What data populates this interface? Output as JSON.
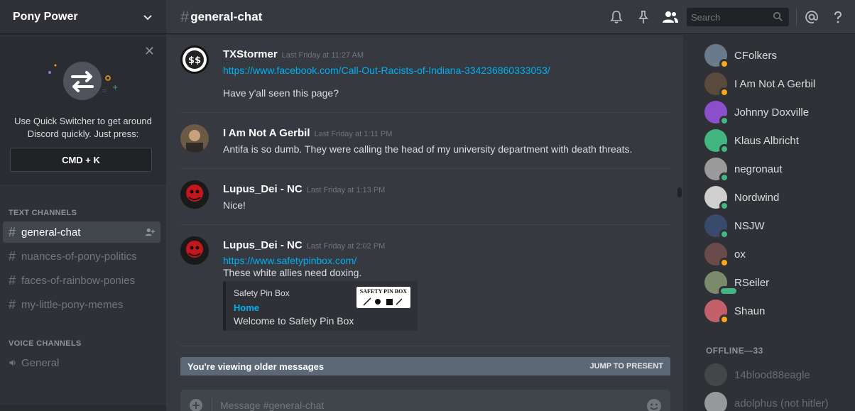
{
  "server": {
    "name": "Pony Power"
  },
  "quick_switcher": {
    "text": "Use Quick Switcher to get around Discord quickly. Just press:",
    "shortcut": "CMD + K"
  },
  "channels": {
    "text_category": "TEXT CHANNELS",
    "text": [
      {
        "name": "general-chat",
        "active": true
      },
      {
        "name": "nuances-of-pony-politics",
        "active": false
      },
      {
        "name": "faces-of-rainbow-ponies",
        "active": false
      },
      {
        "name": "my-little-pony-memes",
        "active": false
      }
    ],
    "voice_category": "VOICE CHANNELS",
    "voice": [
      {
        "name": "General"
      }
    ]
  },
  "header": {
    "channel_name": "general-chat",
    "search_placeholder": "Search"
  },
  "messages": [
    {
      "author": "TXStormer",
      "time": "Last Friday at 11:27 AM",
      "link": "https://www.facebook.com/Call-Out-Racists-of-Indiana-334236860333053/",
      "text": "Have y'all seen this page?"
    },
    {
      "author": "I Am Not A Gerbil",
      "time": "Last Friday at 1:11 PM",
      "text": "Antifa is so dumb. They were calling the head of my university department with death threats."
    },
    {
      "author": "Lupus_Dei - NC",
      "time": "Last Friday at 1:13 PM",
      "text": "Nice!"
    },
    {
      "author": "Lupus_Dei - NC",
      "time": "Last Friday at 2:02 PM",
      "link": "https://www.safetypinbox.com/",
      "text": "These white allies need doxing.",
      "embed": {
        "provider": "Safety Pin Box",
        "title": "Home",
        "description": "Welcome to Safety Pin Box",
        "thumb_text": "SAFETY PIN BOX"
      }
    }
  ],
  "older_bar": {
    "text": "You're viewing older messages",
    "jump": "JUMP TO PRESENT"
  },
  "composer": {
    "placeholder": "Message #general-chat"
  },
  "members": {
    "online": [
      {
        "name": "CFolkers",
        "status": "idle",
        "color": "#dcddde",
        "avatar": "#6b7a8a"
      },
      {
        "name": "I Am Not A Gerbil",
        "status": "idle",
        "color": "#dcddde",
        "avatar": "#5a4a3c"
      },
      {
        "name": "Johnny Doxville",
        "status": "online",
        "color": "#dcddde",
        "avatar": "#8a4fc9"
      },
      {
        "name": "Klaus Albricht",
        "status": "online",
        "color": "#dcddde",
        "avatar": "#43b581"
      },
      {
        "name": "negronaut",
        "status": "online",
        "color": "#dcddde",
        "avatar": "#9a9a9a"
      },
      {
        "name": "Nordwind",
        "status": "online",
        "color": "#dcddde",
        "avatar": "#cfcfcf"
      },
      {
        "name": "NSJW",
        "status": "online",
        "color": "#dcddde",
        "avatar": "#3a4a6a"
      },
      {
        "name": "ox",
        "status": "idle",
        "color": "#dcddde",
        "avatar": "#6a4a4a"
      },
      {
        "name": "RSeiler",
        "status": "stream",
        "color": "#dcddde",
        "avatar": "#7a8a6a"
      },
      {
        "name": "Shaun",
        "status": "idle",
        "color": "#dcddde",
        "avatar": "#c4606a"
      }
    ],
    "offline_category": "OFFLINE—33",
    "offline": [
      {
        "name": "14blood88eagle",
        "color": "#8e9297",
        "avatar": "#555"
      },
      {
        "name": "adolphus (not hitler)",
        "color": "#8e9297",
        "avatar": "#ddd"
      }
    ]
  }
}
